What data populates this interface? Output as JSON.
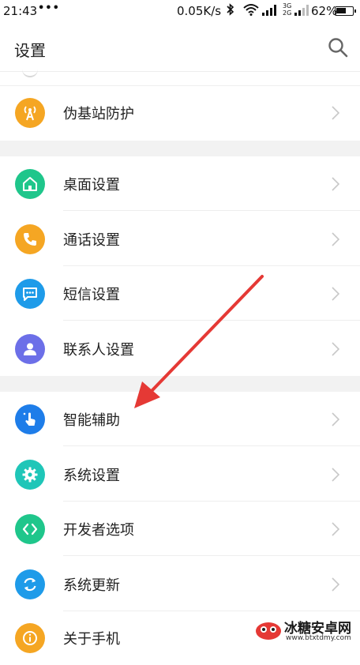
{
  "status": {
    "time": "21:43",
    "dots": "•••",
    "speed": "0.05K/s",
    "net_top": "3G",
    "net_bottom": "2G",
    "battery_pct": "62%",
    "battery_level": 0.62
  },
  "header": {
    "title": "设置"
  },
  "rows": [
    {
      "label": "伪基站防护",
      "icon": "fake-base-station-icon",
      "color": "#F5A623"
    },
    {
      "label": "桌面设置",
      "icon": "home-icon",
      "color": "#1FC68B"
    },
    {
      "label": "通话设置",
      "icon": "phone-icon",
      "color": "#F5A623"
    },
    {
      "label": "短信设置",
      "icon": "message-icon",
      "color": "#1E9BE9"
    },
    {
      "label": "联系人设置",
      "icon": "contact-icon",
      "color": "#6C6FE8"
    },
    {
      "label": "智能辅助",
      "icon": "smart-assist-icon",
      "color": "#1E7DE9"
    },
    {
      "label": "系统设置",
      "icon": "gear-icon",
      "color": "#1FC6B8"
    },
    {
      "label": "开发者选项",
      "icon": "developer-icon",
      "color": "#1FC68B"
    },
    {
      "label": "系统更新",
      "icon": "update-icon",
      "color": "#1E9BE9"
    },
    {
      "label": "关于手机",
      "icon": "info-icon",
      "color": "#F5A623"
    }
  ],
  "watermark": {
    "brand": "冰糖安卓网",
    "url": "www.btxtdmy.com"
  },
  "colors": {
    "section_gap": "#f2f2f2",
    "arrow": "#e53935"
  }
}
